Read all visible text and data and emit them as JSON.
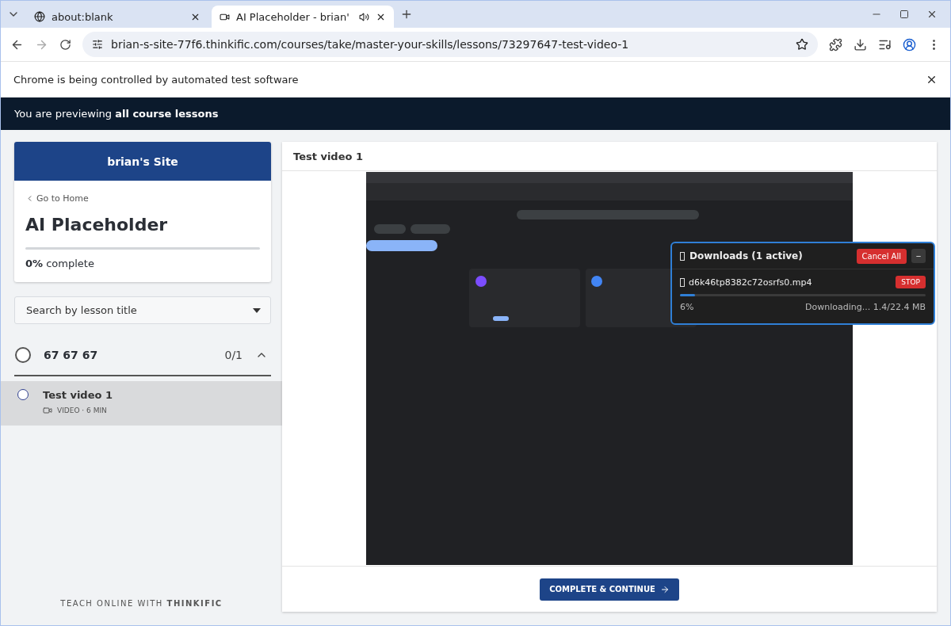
{
  "browser": {
    "tabs": [
      {
        "title": "about:blank",
        "selected": false
      },
      {
        "title": "AI Placeholder - brian'",
        "selected": true
      }
    ],
    "url": "brian-s-site-77f6.thinkific.com/courses/take/master-your-skills/lessons/73297647-test-video-1",
    "infobar": "Chrome is being controlled by automated test software"
  },
  "banner": {
    "text": "You are previewing **all course lessons**"
  },
  "sidebar": {
    "site_name": "brian's Site",
    "back_link": "Go to Home",
    "course_title": "AI Placeholder",
    "progress": {
      "level": 0,
      "percent": "0%",
      "label": "complete"
    },
    "search": {
      "placeholder": "Search by lesson title"
    },
    "chapter": {
      "title": "67 67 67",
      "count": "0/1",
      "expanded": true,
      "completed": false
    },
    "lessons": [
      {
        "title": "Test video 1",
        "meta": "VIDEO · 6 MIN",
        "selected": true,
        "completed": false
      }
    ],
    "footer": "TEACH ONLINE WITH **THINKIFIC**"
  },
  "content": {
    "title": "Test video 1",
    "button": "COMPLETE & CONTINUE"
  },
  "downloads": {
    "title": "Downloads (1 active)",
    "cancel": "Cancel All",
    "minimize": "−",
    "items": [
      {
        "file": "d6k46tp8382c72osrfs0.mp4",
        "stop": "STOP",
        "level": 0.06,
        "percent": "6%",
        "status": "Downloading... 1.4/22.4 MB"
      }
    ]
  }
}
